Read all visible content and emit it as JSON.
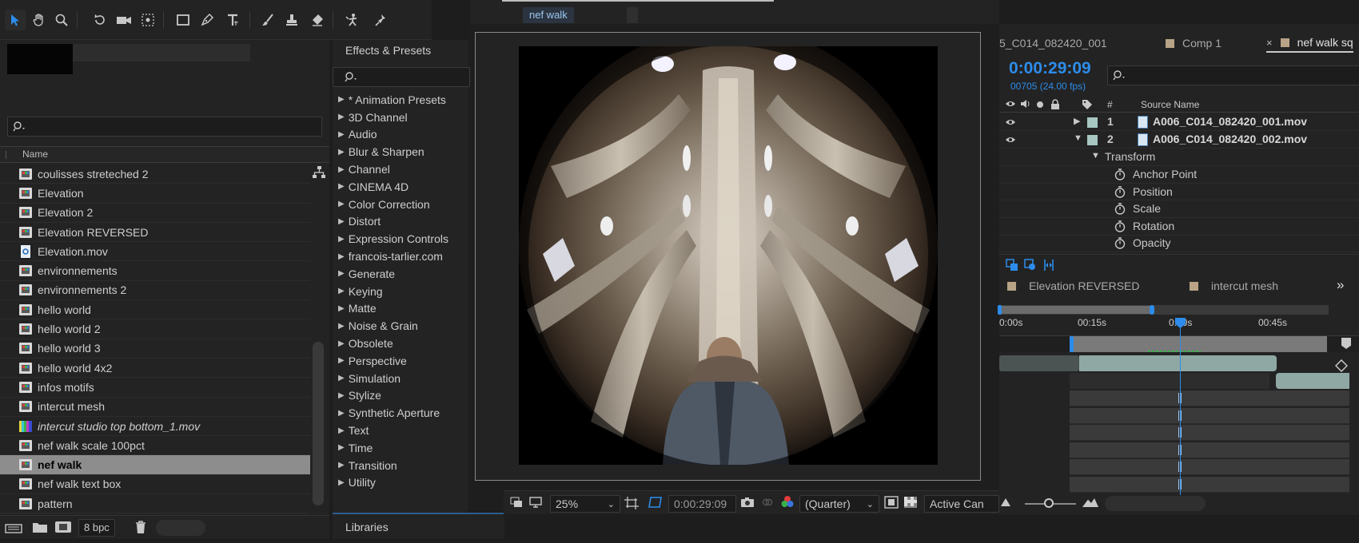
{
  "project": {
    "search_placeholder": "",
    "column_name": "Name",
    "items": [
      {
        "label": "coulisses streteched 2",
        "kind": "comp"
      },
      {
        "label": "Elevation",
        "kind": "comp"
      },
      {
        "label": "Elevation 2",
        "kind": "comp"
      },
      {
        "label": "Elevation REVERSED",
        "kind": "comp"
      },
      {
        "label": "Elevation.mov",
        "kind": "movie"
      },
      {
        "label": "environnements",
        "kind": "comp"
      },
      {
        "label": "environnements 2",
        "kind": "comp"
      },
      {
        "label": "hello world",
        "kind": "comp"
      },
      {
        "label": "hello world 2",
        "kind": "comp"
      },
      {
        "label": "hello world 3",
        "kind": "comp"
      },
      {
        "label": "hello world 4x2",
        "kind": "comp"
      },
      {
        "label": "infos motifs",
        "kind": "comp"
      },
      {
        "label": "intercut mesh",
        "kind": "comp"
      },
      {
        "label": "intercut studio top bottom_1.mov",
        "kind": "footage-italic"
      },
      {
        "label": "nef walk scale 100pct",
        "kind": "comp"
      },
      {
        "label": "nef walk",
        "kind": "comp-selected"
      },
      {
        "label": "nef walk text box",
        "kind": "comp"
      },
      {
        "label": "pattern",
        "kind": "comp"
      }
    ],
    "bpc": "8 bpc"
  },
  "effects": {
    "title": "Effects & Presets",
    "items": [
      "* Animation Presets",
      "3D Channel",
      "Audio",
      "Blur & Sharpen",
      "Channel",
      "CINEMA 4D",
      "Color Correction",
      "Distort",
      "Expression Controls",
      "francois-tarlier.com",
      "Generate",
      "Keying",
      "Matte",
      "Noise & Grain",
      "Obsolete",
      "Perspective",
      "Simulation",
      "Stylize",
      "Synthetic Aperture",
      "Text",
      "Time",
      "Transition",
      "Utility"
    ],
    "libraries_tab": "Libraries"
  },
  "viewer": {
    "comp_tab": "nef walk",
    "zoom": "25%",
    "timecode": "0:00:29:09",
    "resolution": "(Quarter)",
    "camera": "Active Can"
  },
  "timeline": {
    "tabs": [
      "5_C014_082420_001",
      "Comp 1",
      "nef walk sq"
    ],
    "close_glyph": "×",
    "current_time": "0:00:29:09",
    "frame_info": "00705 (24.00 fps)",
    "col_number": "#",
    "col_source": "Source Name",
    "layers": [
      {
        "num": "1",
        "name": "A006_C014_082420_001.mov",
        "expanded": false
      },
      {
        "num": "2",
        "name": "A006_C014_082420_002.mov",
        "expanded": true
      }
    ],
    "transform_label": "Transform",
    "properties": [
      "Anchor Point",
      "Position",
      "Scale",
      "Rotation",
      "Opacity"
    ],
    "flow_items": [
      "Elevation REVERSED",
      "intercut mesh"
    ],
    "ruler": [
      "0:00s",
      "00:15s",
      "0:30s",
      "00:45s"
    ]
  },
  "colors": {
    "accent": "#2d8ceb",
    "swatch": "#b8a386",
    "selection": "#8d8d8d",
    "layer_label": "#a7c6c1"
  }
}
